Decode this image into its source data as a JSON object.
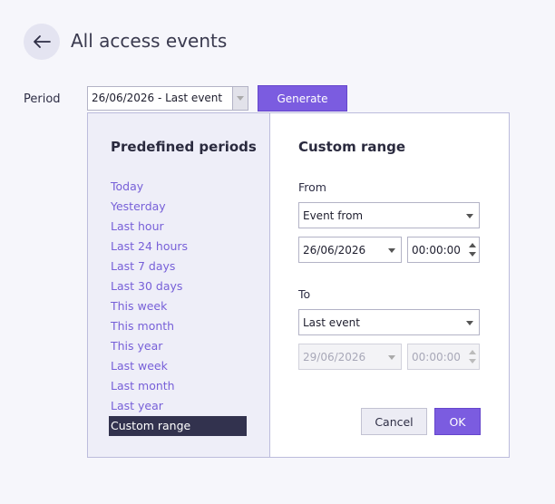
{
  "header": {
    "title": "All access events",
    "back_icon": "arrow-left-icon"
  },
  "toolbar": {
    "period_label": "Period",
    "period_value": "26/06/2026 - Last event",
    "generate_label": "Generate"
  },
  "popup": {
    "predefined": {
      "title": "Predefined periods",
      "items": [
        {
          "label": "Today"
        },
        {
          "label": "Yesterday"
        },
        {
          "label": "Last hour"
        },
        {
          "label": "Last 24 hours"
        },
        {
          "label": "Last 7 days"
        },
        {
          "label": "Last 30 days"
        },
        {
          "label": "This week"
        },
        {
          "label": "This month"
        },
        {
          "label": "This year"
        },
        {
          "label": "Last week"
        },
        {
          "label": "Last month"
        },
        {
          "label": "Last year"
        },
        {
          "label": "Custom range"
        }
      ],
      "selected": "Custom range"
    },
    "custom": {
      "title": "Custom range",
      "from_label": "From",
      "from_type": "Event from",
      "from_date": "26/06/2026",
      "from_time": "00:00:00",
      "to_label": "To",
      "to_type": "Last event",
      "to_date": "29/06/2026",
      "to_time": "00:00:00",
      "cancel_label": "Cancel",
      "ok_label": "OK"
    }
  },
  "colors": {
    "accent": "#7b5ce0",
    "link": "#7760d8",
    "selected_bg": "#32324e"
  }
}
